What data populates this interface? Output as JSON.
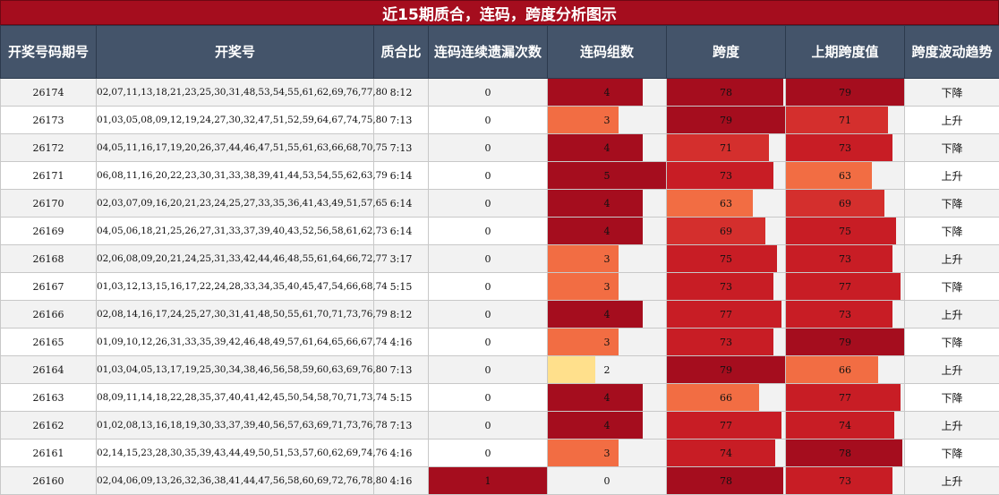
{
  "title": "近15期质合，连码，跨度分析图示",
  "headers": [
    "开奖号码期号",
    "开奖号",
    "质合比",
    "连码连续遗漏次数",
    "连码组数",
    "跨度",
    "上期跨度值",
    "跨度波动趋势"
  ],
  "colors": {
    "title_bg": "#a50d1e",
    "header_bg": "#44546a",
    "level_1": "#a50d1e",
    "level_2": "#d42f2d",
    "level_3": "#c81d25",
    "level_4": "#f26d43",
    "level_5": "#ffe08c",
    "level_6": "#e3f1fa"
  },
  "rows": [
    {
      "period": "26174",
      "numbers": "02,07,11,13,18,21,23,25,30,31,48,53,54,55,61,62,69,76,77,80",
      "ratio": "8:12",
      "miss": "0",
      "groups": "4",
      "span": "78",
      "prev_span": "79",
      "trend": "下降"
    },
    {
      "period": "26173",
      "numbers": "01,03,05,08,09,12,19,24,27,30,32,47,51,52,59,64,67,74,75,80",
      "ratio": "7:13",
      "miss": "0",
      "groups": "3",
      "span": "79",
      "prev_span": "71",
      "trend": "上升"
    },
    {
      "period": "26172",
      "numbers": "04,05,11,16,17,19,20,26,37,44,46,47,51,55,61,63,66,68,70,75",
      "ratio": "7:13",
      "miss": "0",
      "groups": "4",
      "span": "71",
      "prev_span": "73",
      "trend": "下降"
    },
    {
      "period": "26171",
      "numbers": "06,08,11,16,20,22,23,30,31,33,38,39,41,44,53,54,55,62,63,79",
      "ratio": "6:14",
      "miss": "0",
      "groups": "5",
      "span": "73",
      "prev_span": "63",
      "trend": "上升"
    },
    {
      "period": "26170",
      "numbers": "02,03,07,09,16,20,21,23,24,25,27,33,35,36,41,43,49,51,57,65",
      "ratio": "6:14",
      "miss": "0",
      "groups": "4",
      "span": "63",
      "prev_span": "69",
      "trend": "下降"
    },
    {
      "period": "26169",
      "numbers": "04,05,06,18,21,25,26,27,31,33,37,39,40,43,52,56,58,61,62,73",
      "ratio": "6:14",
      "miss": "0",
      "groups": "4",
      "span": "69",
      "prev_span": "75",
      "trend": "下降"
    },
    {
      "period": "26168",
      "numbers": "02,06,08,09,20,21,24,25,31,33,42,44,46,48,55,61,64,66,72,77",
      "ratio": "3:17",
      "miss": "0",
      "groups": "3",
      "span": "75",
      "prev_span": "73",
      "trend": "上升"
    },
    {
      "period": "26167",
      "numbers": "01,03,12,13,15,16,17,22,24,28,33,34,35,40,45,47,54,66,68,74",
      "ratio": "5:15",
      "miss": "0",
      "groups": "3",
      "span": "73",
      "prev_span": "77",
      "trend": "下降"
    },
    {
      "period": "26166",
      "numbers": "02,08,14,16,17,24,25,27,30,31,41,48,50,55,61,70,71,73,76,79",
      "ratio": "8:12",
      "miss": "0",
      "groups": "4",
      "span": "77",
      "prev_span": "73",
      "trend": "上升"
    },
    {
      "period": "26165",
      "numbers": "01,09,10,12,26,31,33,35,39,42,46,48,49,57,61,64,65,66,67,74",
      "ratio": "4:16",
      "miss": "0",
      "groups": "3",
      "span": "73",
      "prev_span": "79",
      "trend": "下降"
    },
    {
      "period": "26164",
      "numbers": "01,03,04,05,13,17,19,25,30,34,38,46,56,58,59,60,63,69,76,80",
      "ratio": "7:13",
      "miss": "0",
      "groups": "2",
      "span": "79",
      "prev_span": "66",
      "trend": "上升"
    },
    {
      "period": "26163",
      "numbers": "08,09,11,14,18,22,28,35,37,40,41,42,45,50,54,58,70,71,73,74",
      "ratio": "5:15",
      "miss": "0",
      "groups": "4",
      "span": "66",
      "prev_span": "77",
      "trend": "下降"
    },
    {
      "period": "26162",
      "numbers": "01,02,08,13,16,18,19,30,33,37,39,40,56,57,63,69,71,73,76,78",
      "ratio": "7:13",
      "miss": "0",
      "groups": "4",
      "span": "77",
      "prev_span": "74",
      "trend": "上升"
    },
    {
      "period": "26161",
      "numbers": "02,14,15,23,28,30,35,39,43,44,49,50,51,53,57,60,62,69,74,76",
      "ratio": "4:16",
      "miss": "0",
      "groups": "3",
      "span": "74",
      "prev_span": "78",
      "trend": "下降"
    },
    {
      "period": "26160",
      "numbers": "02,04,06,09,13,26,32,36,38,41,44,47,56,58,60,69,72,76,78,80",
      "ratio": "4:16",
      "miss": "1",
      "groups": "0",
      "span": "78",
      "prev_span": "73",
      "trend": "上升"
    }
  ]
}
